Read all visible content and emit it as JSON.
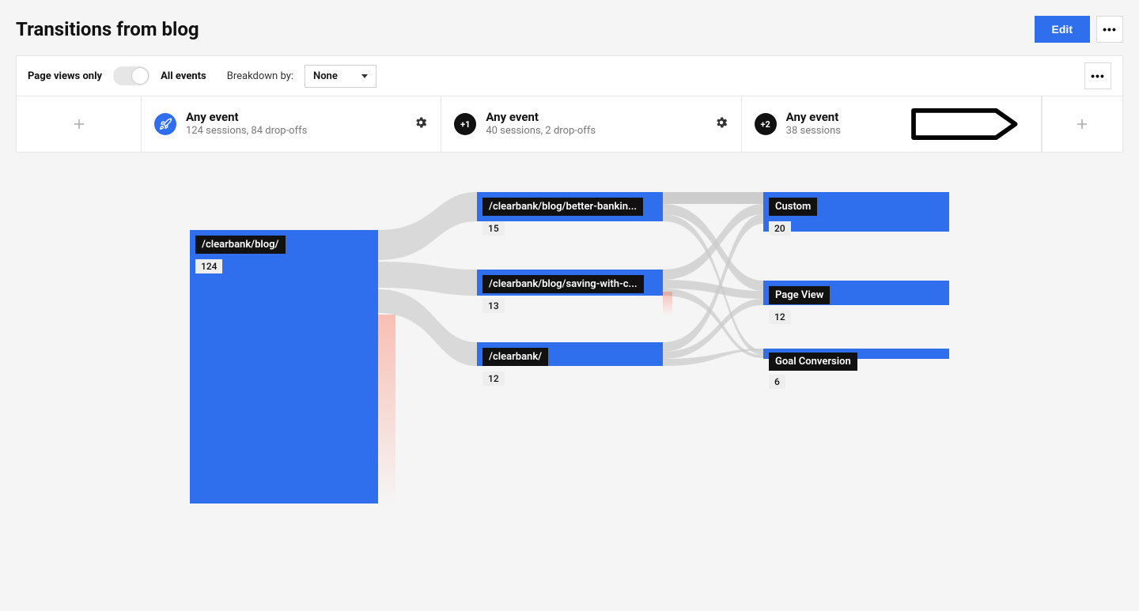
{
  "header": {
    "title": "Transitions from blog",
    "edit": "Edit"
  },
  "controls": {
    "pageViewsOnly": "Page views only",
    "allEvents": "All events",
    "breakdownLabel": "Breakdown by:",
    "breakdownValue": "None"
  },
  "steps": [
    {
      "badge": "rocket",
      "title": "Any event",
      "sub": "124 sessions, 84 drop-offs"
    },
    {
      "badge": "+1",
      "title": "Any event",
      "sub": "40 sessions, 2 drop-offs"
    },
    {
      "badge": "+2",
      "title": "Any event",
      "sub": "38 sessions"
    }
  ],
  "nodes": {
    "col1": {
      "label": "/clearbank/blog/",
      "count": "124"
    },
    "col2": [
      {
        "label": "/clearbank/blog/better-bankin...",
        "count": "15"
      },
      {
        "label": "/clearbank/blog/saving-with-c...",
        "count": "13"
      },
      {
        "label": "/clearbank/",
        "count": "12"
      }
    ],
    "col3": [
      {
        "label": "Custom",
        "count": "20"
      },
      {
        "label": "Page View",
        "count": "12"
      },
      {
        "label": "Goal Conversion",
        "count": "6"
      }
    ]
  },
  "colors": {
    "accent": "#2f6fed"
  }
}
